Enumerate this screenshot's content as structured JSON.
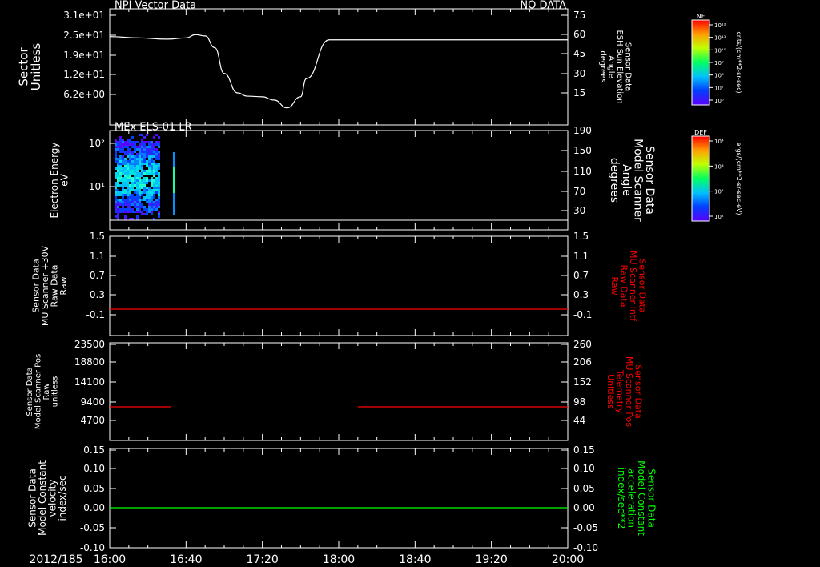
{
  "date_label": "2012/185",
  "time_ticks": [
    "16:00",
    "16:40",
    "17:20",
    "18:00",
    "18:40",
    "19:20",
    "20:00"
  ],
  "chart_data": [
    {
      "type": "line",
      "title_left": "NPI Vector Data",
      "title_right": "NO DATA",
      "ylabel_left": [
        "Sector",
        "Unitless"
      ],
      "yticks_left": [
        "3.1e+01",
        "2.5e+01",
        "1.9e+01",
        "1.2e+01",
        "6.2e+00"
      ],
      "ylabel_right": [
        "Sensor Data",
        "ESH Sun Elevation",
        "Angle",
        "degrees"
      ],
      "yticks_right": [
        "75",
        "60",
        "45",
        "30",
        "15"
      ],
      "ylim_right": [
        0,
        75
      ],
      "series": [
        {
          "color": "#ffffff",
          "x": [
            "16:00",
            "16:15",
            "16:30",
            "16:40",
            "16:45",
            "16:50",
            "16:55",
            "17:00",
            "17:07",
            "17:12",
            "17:20",
            "17:26",
            "17:33",
            "17:40",
            "17:43",
            "17:55",
            "18:10",
            "18:40",
            "19:20",
            "20:00"
          ],
          "y": [
            58.5,
            57.5,
            56.5,
            57.5,
            60,
            59,
            50,
            30,
            15,
            12.5,
            12,
            9.5,
            3.5,
            12,
            26,
            56,
            56,
            56,
            56,
            56
          ]
        }
      ]
    },
    {
      "type": "heatmap",
      "title_left": "MEx ELS-01 LR",
      "ylabel_left": [
        "Electron Energy",
        "eV"
      ],
      "yticks_left": [
        "10²",
        "10¹"
      ],
      "ylabel_right": [
        "Sensor Data",
        "Model Scanner",
        "Angle",
        "degrees"
      ],
      "yticks_right": [
        "190",
        "150",
        "110",
        "70",
        "30"
      ],
      "note": "spectrogram of electron counts between 16:00 and about 16:27, plus a short narrow column near 16:34"
    },
    {
      "type": "line",
      "ylabel_left": [
        "Sensor Data",
        "MU Scanner +30V",
        "Raw Data",
        "Raw"
      ],
      "yticks_left": [
        "1.5",
        "1.1",
        "0.7",
        "0.3",
        "-0.1"
      ],
      "ylabel_right": [
        "Sensor Data",
        "MU Scanner Intf",
        "Raw Data",
        "Raw"
      ],
      "yticks_right": [
        "1.5",
        "1.1",
        "0.7",
        "0.3",
        "-0.1"
      ],
      "ylim": [
        -0.3,
        1.5
      ],
      "series": [
        {
          "color": "#ff0000",
          "x": [
            "16:00",
            "20:00"
          ],
          "y": [
            0,
            0
          ]
        }
      ]
    },
    {
      "type": "line",
      "ylabel_left": [
        "Sensor Data",
        "Model Scanner Pos",
        "Raw",
        "unitless"
      ],
      "yticks_left": [
        "23500",
        "18800",
        "14100",
        "9400",
        "4700"
      ],
      "ylabel_right": [
        "Sensor Data",
        "MU Scanner Pos",
        "Telemetry",
        "Unitless"
      ],
      "yticks_right": [
        "260",
        "206",
        "152",
        "98",
        "44"
      ],
      "ylim_left": [
        0,
        23500
      ],
      "series": [
        {
          "color": "#ff0000",
          "x": [
            "16:00",
            "16:32"
          ],
          "y": [
            8000,
            8000
          ]
        },
        {
          "color": "#ff0000",
          "x": [
            "18:10",
            "20:00"
          ],
          "y": [
            8000,
            8000
          ]
        }
      ]
    },
    {
      "type": "line",
      "ylabel_left": [
        "Sensor Data",
        "Model Constant",
        "velocity",
        "index/sec"
      ],
      "yticks_left": [
        "0.15",
        "0.10",
        "0.05",
        "0.00",
        "-0.05",
        "-0.10"
      ],
      "ylabel_right": [
        "Sensor Data",
        "Model Constant",
        "acceleration",
        "index/sec**2"
      ],
      "yticks_right": [
        "0.15",
        "0.10",
        "0.05",
        "0.00",
        "-0.05",
        "-0.10"
      ],
      "ylim": [
        -0.1,
        0.15
      ],
      "series": [
        {
          "color": "#00ff00",
          "x": [
            "16:00",
            "20:00"
          ],
          "y": [
            0,
            0
          ]
        }
      ]
    }
  ],
  "colorbars": [
    {
      "title": "NF",
      "ticks": [
        "10¹²",
        "10¹¹",
        "10¹⁰",
        "10⁹",
        "10⁸",
        "10⁷",
        "10⁶"
      ],
      "units": "cnts/(cm**2-sr-sec)"
    },
    {
      "title": "DEF",
      "ticks": [
        "10⁴",
        "10³",
        "10²",
        "10¹"
      ],
      "units": "ergs/(cm**2-sr-sec-eV)"
    }
  ],
  "colors": {
    "background": "#000000",
    "axes": "#ffffff",
    "red_label": "#ff0000",
    "green_label": "#00ff00"
  }
}
